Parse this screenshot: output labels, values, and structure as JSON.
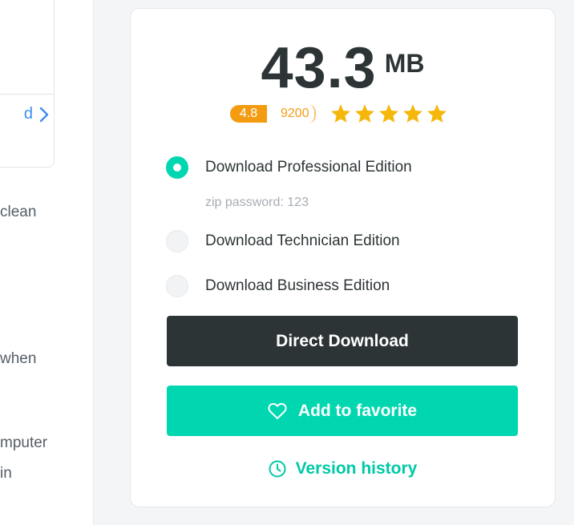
{
  "left": {
    "link_text": "d",
    "snippets": [
      "clean",
      "when",
      "mputer",
      "in"
    ]
  },
  "file": {
    "size_value": "43.3",
    "size_unit": "MB"
  },
  "rating": {
    "score": "4.8",
    "count": "9200",
    "stars": 5
  },
  "options": [
    {
      "label": "Download Professional Edition",
      "selected": true
    },
    {
      "label": "Download Technician Edition",
      "selected": false
    },
    {
      "label": "Download Business Edition",
      "selected": false
    }
  ],
  "zip_note": "zip password: 123",
  "buttons": {
    "direct_download": "Direct Download",
    "add_favorite": "Add to favorite",
    "version_history": "Version history"
  },
  "colors": {
    "accent": "#00d7b0",
    "dark": "#2d3436",
    "rating": "#f39c12",
    "star": "#f5b70a"
  },
  "icons": {
    "favorite": "heart-icon",
    "history": "clock-icon",
    "more": "chevron-right-icon",
    "rating": "star-icon"
  }
}
